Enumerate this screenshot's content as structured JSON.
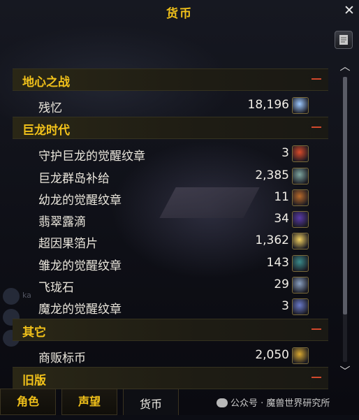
{
  "window": {
    "title": "货币"
  },
  "categories": [
    {
      "label": "地心之战",
      "items": [
        {
          "name": "残忆",
          "value": "18,196",
          "icon": "remnant-icon",
          "color": "#9ec9ff"
        }
      ]
    },
    {
      "label": "巨龙时代",
      "items": [
        {
          "name": "守护巨龙的觉醒纹章",
          "value": "3",
          "icon": "aspect-crest-icon",
          "color": "#d94a2a"
        },
        {
          "name": "巨龙群岛补给",
          "value": "2,385",
          "icon": "supplies-icon",
          "color": "#7fa6a0"
        },
        {
          "name": "幼龙的觉醒纹章",
          "value": "11",
          "icon": "whelpling-crest-icon",
          "color": "#b96a2a"
        },
        {
          "name": "翡翠露滴",
          "value": "34",
          "icon": "dewdrop-icon",
          "color": "#5a3aa8"
        },
        {
          "name": "超因果箔片",
          "value": "1,362",
          "icon": "paracausal-flake-icon",
          "color": "#f2d060"
        },
        {
          "name": "雏龙的觉醒纹章",
          "value": "143",
          "icon": "drake-crest-icon",
          "color": "#3a8a8a"
        },
        {
          "name": "飞珑石",
          "value": "29",
          "icon": "flightstone-icon",
          "color": "#8aa0c0"
        },
        {
          "name": "魔龙的觉醒纹章",
          "value": "3",
          "icon": "wyrm-crest-icon",
          "color": "#6a7ac8"
        }
      ]
    },
    {
      "label": "其它",
      "items": [
        {
          "name": "商贩标币",
          "value": "2,050",
          "icon": "trader-tender-icon",
          "color": "#d9a830"
        }
      ]
    },
    {
      "label": "旧版",
      "items": []
    }
  ],
  "tabs": [
    {
      "label": "角色"
    },
    {
      "label": "声望"
    },
    {
      "label": "货币"
    }
  ],
  "watermark": {
    "text": "公众号 · 魔兽世界研究所"
  },
  "colors": {
    "accent": "#f2c21a",
    "collapse": "#d2492c"
  }
}
